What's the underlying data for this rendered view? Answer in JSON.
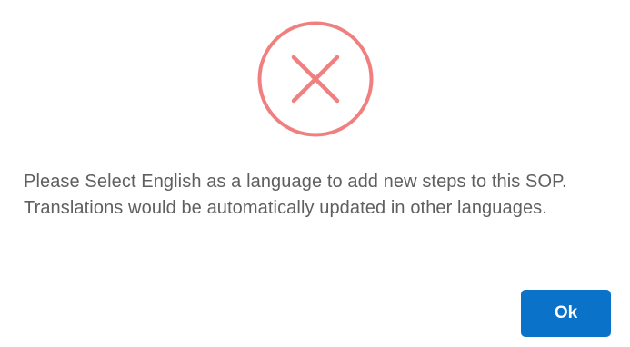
{
  "dialog": {
    "icon": "error-x-circle-icon",
    "icon_color": "#f08080",
    "message": "Please Select English as a language to add new steps to this SOP. Translations would be automatically updated in other languages.",
    "ok_label": "Ok",
    "button_color": "#0b72c9"
  }
}
